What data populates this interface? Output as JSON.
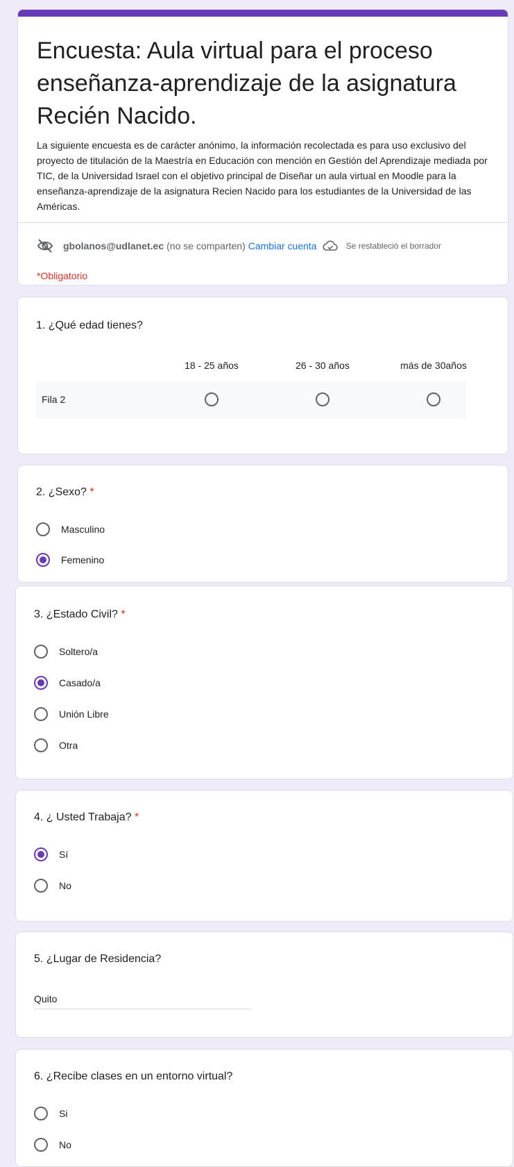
{
  "header": {
    "title": "Encuesta: Aula virtual para el proceso enseñanza-aprendizaje de la asignatura Recién Nacido.",
    "description": "La siguiente encuesta es de carácter anónimo, la información recolectada es para uso exclusivo del proyecto de titulación de la Maestría en Educación con mención en Gestión del Aprendizaje mediada por TIC, de la Universidad Israel con el objetivo principal de Diseñar un aula virtual en Moodle para la enseñanza-aprendizaje de la asignatura Recien Nacido para los estudiantes de la Universidad de las Américas.",
    "email": "gbolanos@udlanet.ec",
    "not_shared": "(no se comparten)",
    "switch_account": "Cambiar cuenta",
    "draft_status": "Se restableció el borrador",
    "required_note": "*Obligatorio"
  },
  "q1": {
    "title": "1. ¿Qué edad tienes?",
    "columns": [
      "18 - 25 años",
      "26 - 30 años",
      "más de 30años"
    ],
    "row_label": "Fila 2"
  },
  "q2": {
    "title": "2. ¿Sexo?",
    "required_mark": "*",
    "options": [
      "Masculino",
      "Femenino"
    ],
    "selected": "Femenino"
  },
  "q3": {
    "title": "3. ¿Estado Civil?",
    "required_mark": "*",
    "options": [
      "Soltero/a",
      "Casado/a",
      "Unión Libre",
      "Otra"
    ],
    "selected": "Casado/a"
  },
  "q4": {
    "title": "4. ¿ Usted Trabaja?",
    "required_mark": "*",
    "options": [
      "Sí",
      "No"
    ],
    "selected": "Sí"
  },
  "q5": {
    "title": "5. ¿Lugar de Residencia?",
    "answer": "Quito"
  },
  "q6": {
    "title": "6. ¿Recibe clases en un entorno virtual?",
    "options": [
      "Si",
      "No"
    ]
  },
  "colors": {
    "accent": "#673ab7",
    "background": "#f0ebf8",
    "required": "#d93025",
    "link": "#1a73e8"
  },
  "icons": [
    "eye-off-icon",
    "cloud-check-icon",
    "radio-button-icon"
  ]
}
